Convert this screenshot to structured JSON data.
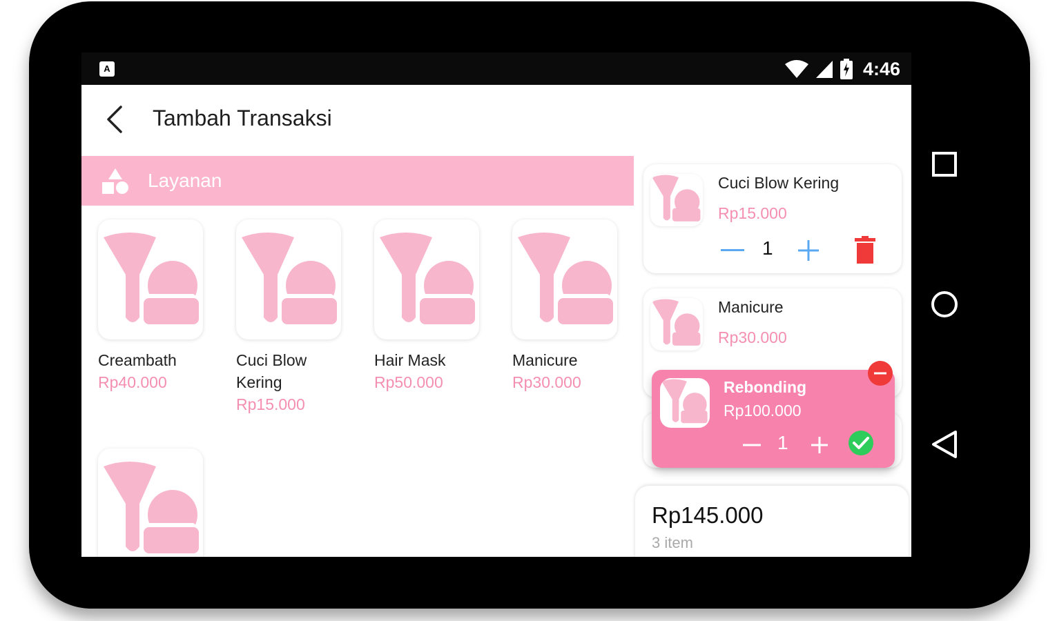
{
  "status_bar": {
    "time": "4:46",
    "notification": "A"
  },
  "app_bar": {
    "title": "Tambah Transaksi"
  },
  "category": {
    "label": "Layanan"
  },
  "products": [
    {
      "name": "Creambath",
      "price": "Rp40.000"
    },
    {
      "name": "Cuci Blow Kering",
      "price": "Rp15.000"
    },
    {
      "name": "Hair Mask",
      "price": "Rp50.000"
    },
    {
      "name": "Manicure",
      "price": "Rp30.000"
    },
    {
      "name": "",
      "price": ""
    }
  ],
  "cart": {
    "items": [
      {
        "name": "Cuci Blow Kering",
        "price": "Rp15.000",
        "qty": "1"
      },
      {
        "name": "Manicure",
        "price": "Rp30.000",
        "qty": "1"
      }
    ],
    "dragging": {
      "name": "Rebonding",
      "price": "Rp100.000",
      "qty": "1"
    },
    "total": {
      "amount": "Rp145.000",
      "count": "3 item"
    }
  },
  "colors": {
    "accent_pink": "#fbb6ce",
    "price_pink": "#f48fb1",
    "drag_card_pink": "#f783ac",
    "stepper_blue": "#5aa8f2",
    "delete_red": "#f03a3a",
    "confirm_green": "#2ecc5a"
  },
  "icons": {
    "back": "arrow-back-icon",
    "category": "shapes-icon",
    "product": "makeup-brush-icon",
    "minus": "minus-icon",
    "plus": "plus-icon",
    "delete": "trash-icon",
    "confirm": "check-circle-icon",
    "remove": "remove-circle-icon"
  }
}
